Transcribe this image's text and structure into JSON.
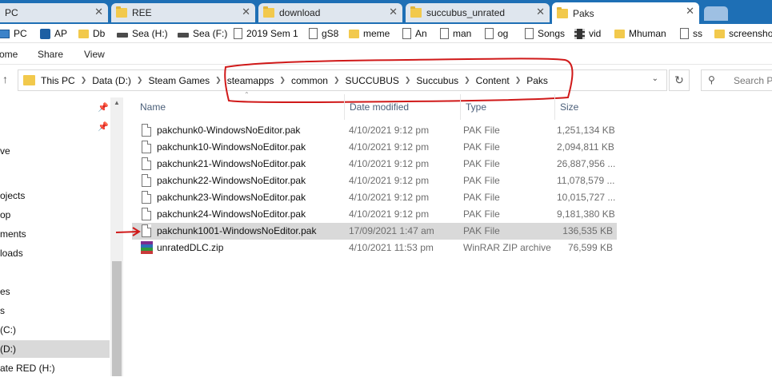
{
  "tabs": [
    {
      "label": "PC",
      "active": false
    },
    {
      "label": "REE",
      "active": false
    },
    {
      "label": "download",
      "active": false
    },
    {
      "label": "succubus_unrated",
      "active": false
    },
    {
      "label": "Paks",
      "active": true
    }
  ],
  "bookmarks": [
    {
      "label": "PC",
      "icon": "pc-icon"
    },
    {
      "label": "AP",
      "icon": "app-icon"
    },
    {
      "label": "Db",
      "icon": "folder-icon"
    },
    {
      "label": "Sea (H:)",
      "icon": "drive-icon"
    },
    {
      "label": "Sea (F:)",
      "icon": "drive-icon"
    },
    {
      "label": "2019 Sem 1",
      "icon": "page-icon"
    },
    {
      "label": "gS8",
      "icon": "page-icon"
    },
    {
      "label": "meme",
      "icon": "folder-icon"
    },
    {
      "label": "An",
      "icon": "page-icon"
    },
    {
      "label": "man",
      "icon": "page-icon"
    },
    {
      "label": "og",
      "icon": "page-icon"
    },
    {
      "label": "Songs",
      "icon": "page-icon"
    },
    {
      "label": "vid",
      "icon": "film-icon"
    },
    {
      "label": "Mhuman",
      "icon": "folder-icon"
    },
    {
      "label": "ss",
      "icon": "page-icon"
    },
    {
      "label": "screensho",
      "icon": "folder-icon"
    }
  ],
  "ribbon": {
    "home": "ome",
    "share": "Share",
    "view": "View"
  },
  "address": {
    "crumbs": [
      "This PC",
      "Data (D:)",
      "Steam Games",
      "steamapps",
      "common",
      "SUCCUBUS",
      "Succubus",
      "Content",
      "Paks"
    ],
    "search_placeholder": "Search Pa"
  },
  "nav": {
    "items": [
      "ve",
      "",
      "ojects",
      "op",
      "ments",
      "loads",
      "",
      "es",
      "s",
      "(C:)",
      "(D:)",
      "ate RED (H:)"
    ],
    "selected": "(D:)"
  },
  "columns": {
    "name": "Name",
    "date": "Date modified",
    "type": "Type",
    "size": "Size"
  },
  "files": [
    {
      "name": "pakchunk0-WindowsNoEditor.pak",
      "date": "4/10/2021 9:12 pm",
      "type": "PAK File",
      "size": "1,251,134 KB",
      "icon": "file-icon"
    },
    {
      "name": "pakchunk10-WindowsNoEditor.pak",
      "date": "4/10/2021 9:12 pm",
      "type": "PAK File",
      "size": "2,094,811 KB",
      "icon": "file-icon"
    },
    {
      "name": "pakchunk21-WindowsNoEditor.pak",
      "date": "4/10/2021 9:12 pm",
      "type": "PAK File",
      "size": "26,887,956 ...",
      "icon": "file-icon"
    },
    {
      "name": "pakchunk22-WindowsNoEditor.pak",
      "date": "4/10/2021 9:12 pm",
      "type": "PAK File",
      "size": "11,078,579 ...",
      "icon": "file-icon"
    },
    {
      "name": "pakchunk23-WindowsNoEditor.pak",
      "date": "4/10/2021 9:12 pm",
      "type": "PAK File",
      "size": "10,015,727 ...",
      "icon": "file-icon"
    },
    {
      "name": "pakchunk24-WindowsNoEditor.pak",
      "date": "4/10/2021 9:12 pm",
      "type": "PAK File",
      "size": "9,181,380 KB",
      "icon": "file-icon"
    },
    {
      "name": "pakchunk1001-WindowsNoEditor.pak",
      "date": "17/09/2021 1:47 am",
      "type": "PAK File",
      "size": "136,535 KB",
      "icon": "file-icon",
      "highlighted": true
    },
    {
      "name": "unratedDLC.zip",
      "date": "4/10/2021 11:53 pm",
      "type": "WinRAR ZIP archive",
      "size": "76,599 KB",
      "icon": "winrar-zip-icon"
    }
  ],
  "colors": {
    "tabbar": "#1e6fb5",
    "annotation": "#d01919",
    "selection": "#d9d9d9",
    "folder": "#f2c94c"
  }
}
